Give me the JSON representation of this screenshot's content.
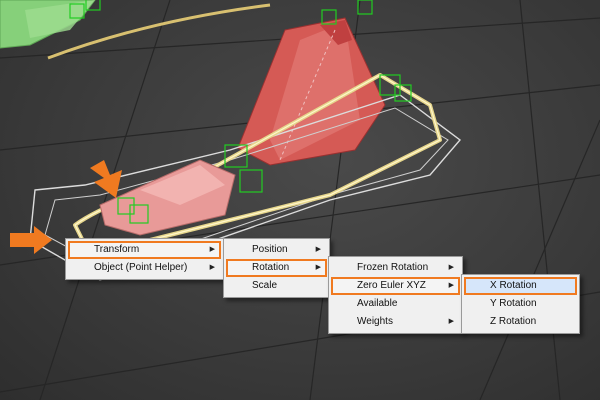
{
  "colors": {
    "highlight": "#f07a20",
    "selected_bg": "#d6e6fa",
    "menu_bg": "#f0f0f0"
  },
  "icons": {
    "submenu": "triangle-right-icon",
    "pointer": "orange-arrow-icon"
  },
  "menus": {
    "level1": {
      "items": [
        {
          "label": "Transform",
          "has_submenu": true,
          "highlighted": true
        },
        {
          "label": "Object (Point Helper)",
          "has_submenu": true,
          "highlighted": false
        }
      ]
    },
    "level2": {
      "items": [
        {
          "label": "Position",
          "has_submenu": true,
          "highlighted": false
        },
        {
          "label": "Rotation",
          "has_submenu": true,
          "highlighted": true
        },
        {
          "label": "Scale",
          "has_submenu": false,
          "highlighted": false
        }
      ]
    },
    "level3": {
      "items": [
        {
          "label": "Frozen Rotation",
          "has_submenu": true,
          "highlighted": false
        },
        {
          "label": "Zero Euler XYZ",
          "has_submenu": true,
          "highlighted": true
        },
        {
          "label": "Available",
          "has_submenu": false,
          "highlighted": false
        },
        {
          "label": "Weights",
          "has_submenu": true,
          "highlighted": false
        }
      ]
    },
    "level4": {
      "items": [
        {
          "label": "X Rotation",
          "has_submenu": false,
          "highlighted": true,
          "selected": true
        },
        {
          "label": "Y Rotation",
          "has_submenu": false,
          "highlighted": false
        },
        {
          "label": "Z Rotation",
          "has_submenu": false,
          "highlighted": false
        }
      ]
    }
  }
}
